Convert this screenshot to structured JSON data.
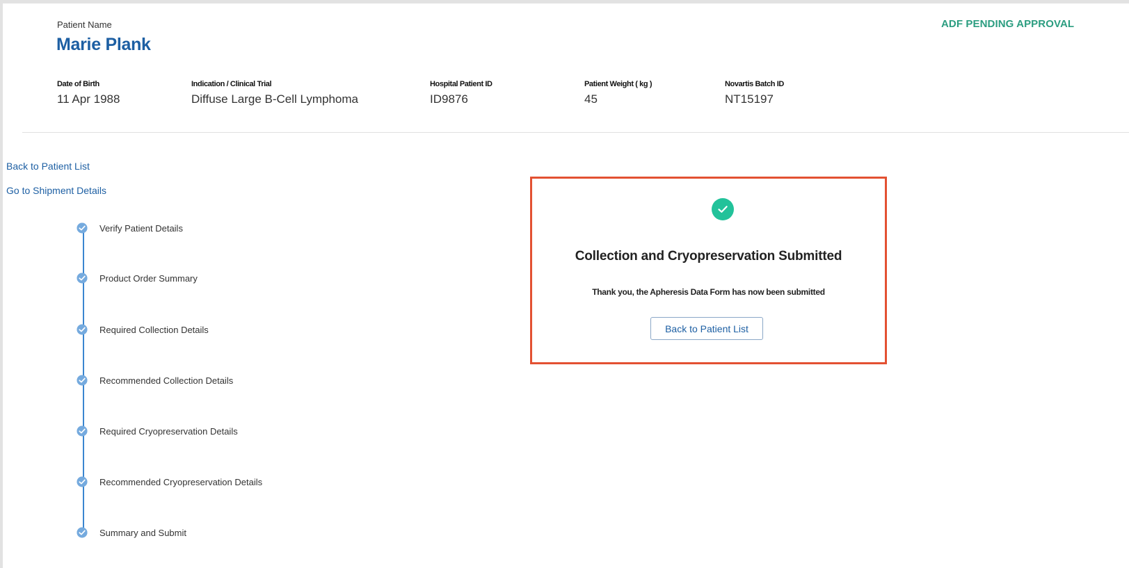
{
  "patient": {
    "name_label": "Patient Name",
    "name": "Marie Plank",
    "status": "ADF PENDING APPROVAL",
    "fields": [
      {
        "label": "Date of Birth",
        "value": "11 Apr 1988"
      },
      {
        "label": "Indication / Clinical Trial",
        "value": "Diffuse Large B-Cell Lymphoma"
      },
      {
        "label": "Hospital Patient ID",
        "value": "ID9876"
      },
      {
        "label": "Patient Weight ( kg )",
        "value": "45"
      },
      {
        "label": "Novartis Batch ID",
        "value": "NT15197"
      }
    ]
  },
  "nav": {
    "back_to_patient_list": "Back to Patient List",
    "go_to_shipment_details": "Go to Shipment Details"
  },
  "steps": [
    {
      "label": "Verify Patient Details",
      "icon": "check-circle-icon"
    },
    {
      "label": "Product Order Summary",
      "icon": "check-circle-icon"
    },
    {
      "label": "Required Collection Details",
      "icon": "check-circle-icon"
    },
    {
      "label": "Recommended Collection Details",
      "icon": "check-circle-icon"
    },
    {
      "label": "Required Cryopreservation Details",
      "icon": "check-circle-icon"
    },
    {
      "label": "Recommended Cryopreservation Details",
      "icon": "check-circle-icon"
    },
    {
      "label": "Summary and Submit",
      "icon": "check-circle-icon"
    }
  ],
  "confirmation": {
    "title": "Collection and Cryopreservation Submitted",
    "message": "Thank you, the Apheresis Data Form has now been submitted",
    "button_label": "Back to Patient List",
    "icon": "check-circle-icon"
  },
  "colors": {
    "brand_blue": "#1d5fa3",
    "status_green": "#2b9d80",
    "success_green": "#22c29a",
    "highlight_border": "#e35132"
  }
}
